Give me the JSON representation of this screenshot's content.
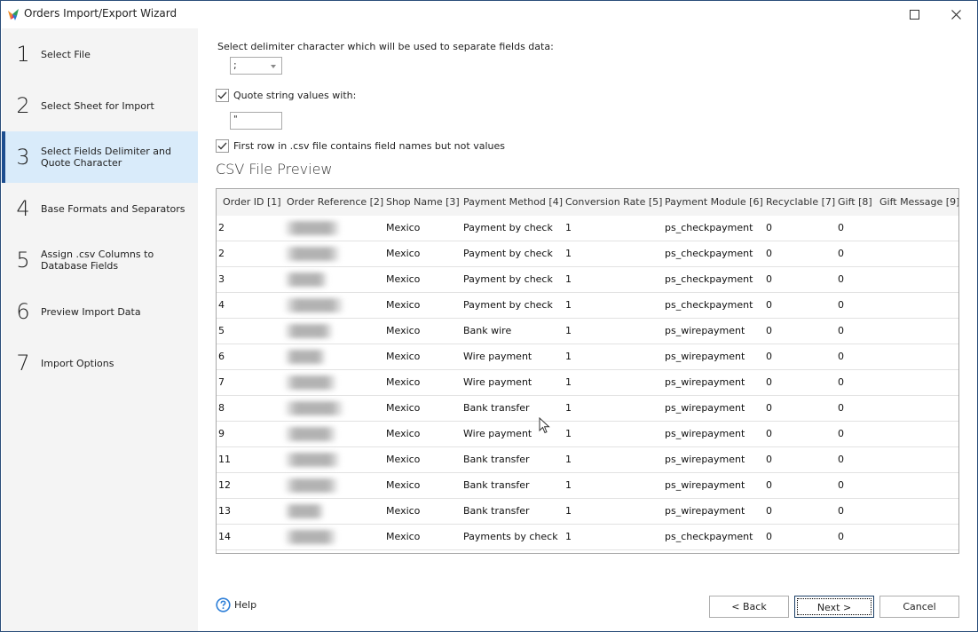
{
  "window": {
    "title": "Orders Import/Export Wizard",
    "controls": [
      "maximize",
      "close"
    ]
  },
  "sidebar": {
    "steps": [
      {
        "number": "1",
        "label": "Select File",
        "active": false
      },
      {
        "number": "2",
        "label": "Select Sheet for Import",
        "active": false
      },
      {
        "number": "3",
        "label": "Select Fields Delimiter and Quote Character",
        "active": true
      },
      {
        "number": "4",
        "label": "Base Formats and Separators",
        "active": false
      },
      {
        "number": "5",
        "label": "Assign .csv Columns to Database Fields",
        "active": false
      },
      {
        "number": "6",
        "label": "Preview Import Data",
        "active": false
      },
      {
        "number": "7",
        "label": "Import Options",
        "active": false
      }
    ]
  },
  "form": {
    "delimiter_label": "Select delimiter character which will be used to separate fields data:",
    "delimiter_value": ";",
    "quote_label": "Quote string values with:",
    "quote_checked": true,
    "quote_value": "\"",
    "first_row_label": "First row in .csv file contains field names but not values",
    "first_row_checked": true
  },
  "preview": {
    "title": "CSV File Preview",
    "columns": [
      "Order ID [1]",
      "Order Reference [2]",
      "Shop Name [3]",
      "Payment Method [4]",
      "Conversion Rate [5]",
      "Payment Module [6]",
      "Recyclable [7]",
      "Gift [8]",
      "Gift Message [9]"
    ],
    "rows": [
      {
        "order_id": "2",
        "order_reference": "[blurred]",
        "shop_name": "Mexico",
        "payment_method": "Payment by check",
        "conversion_rate": "1",
        "payment_module": "ps_checkpayment",
        "recyclable": "0",
        "gift": "0",
        "gift_message": ""
      },
      {
        "order_id": "2",
        "order_reference": "[blurred]",
        "shop_name": "Mexico",
        "payment_method": "Payment by check",
        "conversion_rate": "1",
        "payment_module": "ps_checkpayment",
        "recyclable": "0",
        "gift": "0",
        "gift_message": ""
      },
      {
        "order_id": "3",
        "order_reference": "[blurred]",
        "shop_name": "Mexico",
        "payment_method": "Payment by check",
        "conversion_rate": "1",
        "payment_module": "ps_checkpayment",
        "recyclable": "0",
        "gift": "0",
        "gift_message": ""
      },
      {
        "order_id": "4",
        "order_reference": "[blurred]",
        "shop_name": "Mexico",
        "payment_method": "Payment by check",
        "conversion_rate": "1",
        "payment_module": "ps_checkpayment",
        "recyclable": "0",
        "gift": "0",
        "gift_message": ""
      },
      {
        "order_id": "5",
        "order_reference": "[blurred]",
        "shop_name": "Mexico",
        "payment_method": "Bank wire",
        "conversion_rate": "1",
        "payment_module": "ps_wirepayment",
        "recyclable": "0",
        "gift": "0",
        "gift_message": ""
      },
      {
        "order_id": "6",
        "order_reference": "[blurred]",
        "shop_name": "Mexico",
        "payment_method": "Wire payment",
        "conversion_rate": "1",
        "payment_module": "ps_wirepayment",
        "recyclable": "0",
        "gift": "0",
        "gift_message": ""
      },
      {
        "order_id": "7",
        "order_reference": "[blurred]",
        "shop_name": "Mexico",
        "payment_method": "Wire payment",
        "conversion_rate": "1",
        "payment_module": "ps_wirepayment",
        "recyclable": "0",
        "gift": "0",
        "gift_message": ""
      },
      {
        "order_id": "8",
        "order_reference": "[blurred]",
        "shop_name": "Mexico",
        "payment_method": "Bank transfer",
        "conversion_rate": "1",
        "payment_module": "ps_wirepayment",
        "recyclable": "0",
        "gift": "0",
        "gift_message": ""
      },
      {
        "order_id": "9",
        "order_reference": "[blurred]",
        "shop_name": "Mexico",
        "payment_method": "Wire payment",
        "conversion_rate": "1",
        "payment_module": "ps_wirepayment",
        "recyclable": "0",
        "gift": "0",
        "gift_message": ""
      },
      {
        "order_id": "11",
        "order_reference": "[blurred]",
        "shop_name": "Mexico",
        "payment_method": "Bank transfer",
        "conversion_rate": "1",
        "payment_module": "ps_wirepayment",
        "recyclable": "0",
        "gift": "0",
        "gift_message": ""
      },
      {
        "order_id": "12",
        "order_reference": "[blurred]",
        "shop_name": "Mexico",
        "payment_method": "Bank transfer",
        "conversion_rate": "1",
        "payment_module": "ps_wirepayment",
        "recyclable": "0",
        "gift": "0",
        "gift_message": ""
      },
      {
        "order_id": "13",
        "order_reference": "[blurred]",
        "shop_name": "Mexico",
        "payment_method": "Bank transfer",
        "conversion_rate": "1",
        "payment_module": "ps_wirepayment",
        "recyclable": "0",
        "gift": "0",
        "gift_message": ""
      },
      {
        "order_id": "14",
        "order_reference": "[blurred]",
        "shop_name": "Mexico",
        "payment_method": "Payments by check",
        "conversion_rate": "1",
        "payment_module": "ps_checkpayment",
        "recyclable": "0",
        "gift": "0",
        "gift_message": ""
      }
    ]
  },
  "footer": {
    "help_label": "Help",
    "back_label": "< Back",
    "next_label": "Next >",
    "cancel_label": "Cancel"
  },
  "colors": {
    "active_step_bg": "#d9ebfa",
    "active_step_accent": "#1c4d8f",
    "sidebar_bg": "#f4f4f4",
    "help_icon": "#2d7fd8"
  }
}
